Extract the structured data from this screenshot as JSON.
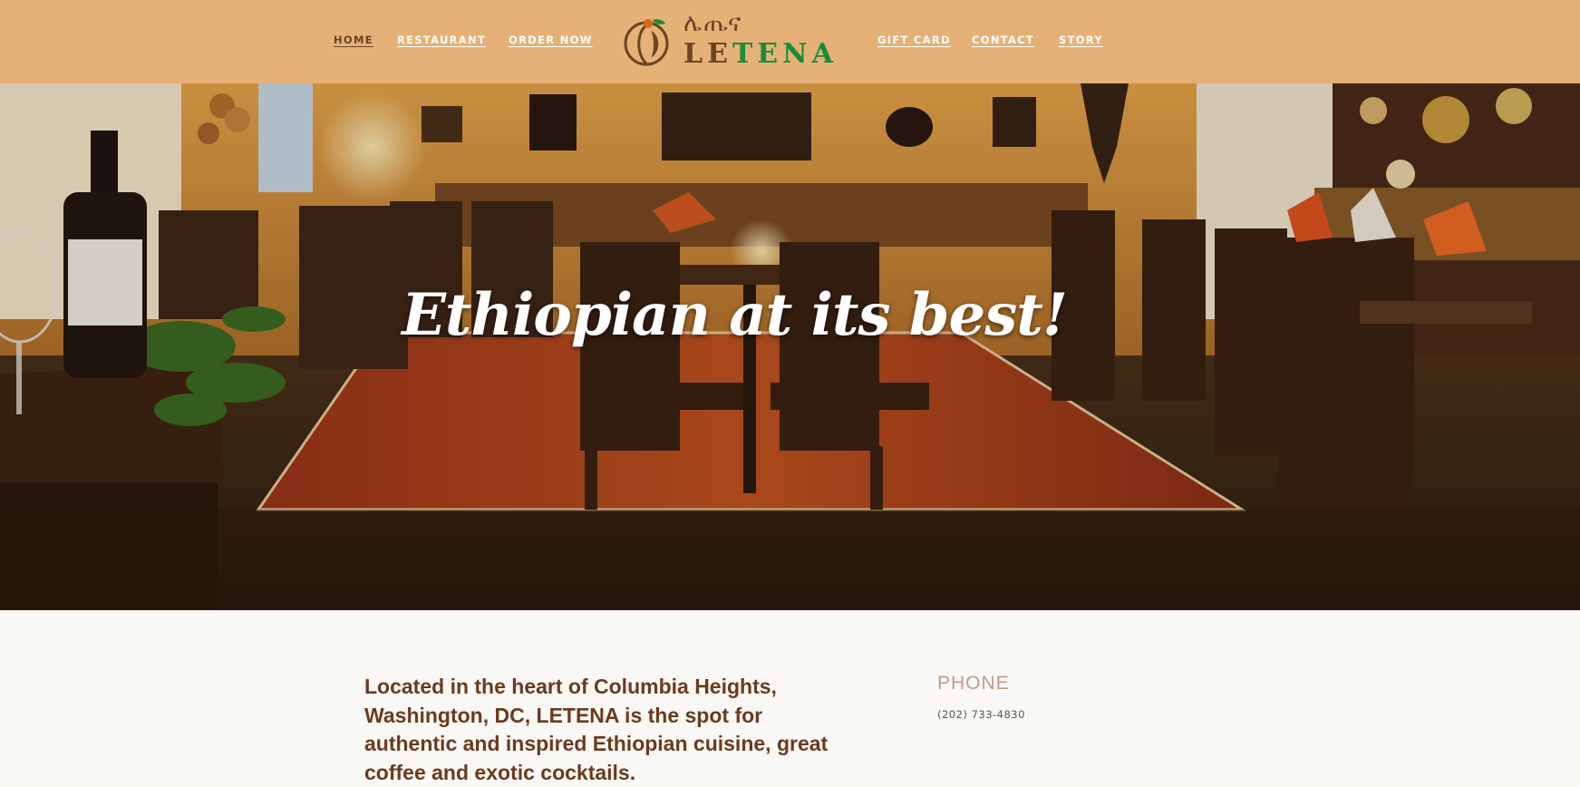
{
  "nav": {
    "left": [
      "HOME",
      "RESTAURANT",
      "ORDER NOW"
    ],
    "right": [
      "GIFT CARD",
      "CONTACT",
      "STORY"
    ],
    "active": "HOME"
  },
  "logo": {
    "amharic": "ሌጤና",
    "word_part1": "LE",
    "word_part2": "TENA"
  },
  "hero": {
    "headline": "Ethiopian at its best!"
  },
  "about": {
    "text": "Located in the heart of Columbia Heights, Washington, DC, LETENA is the spot for authentic and inspired Ethiopian cuisine, great coffee and exotic cocktails."
  },
  "contact": {
    "phone_label": "PHONE",
    "phone_value": "(202) 733-4830"
  },
  "colors": {
    "header_bg": "#e6b176",
    "brand_green": "#1a8c3a",
    "brand_brown": "#6b4424",
    "body_bg": "#faf8f5",
    "intro_text": "#6b3a1f",
    "phone_label": "#c49a85"
  }
}
